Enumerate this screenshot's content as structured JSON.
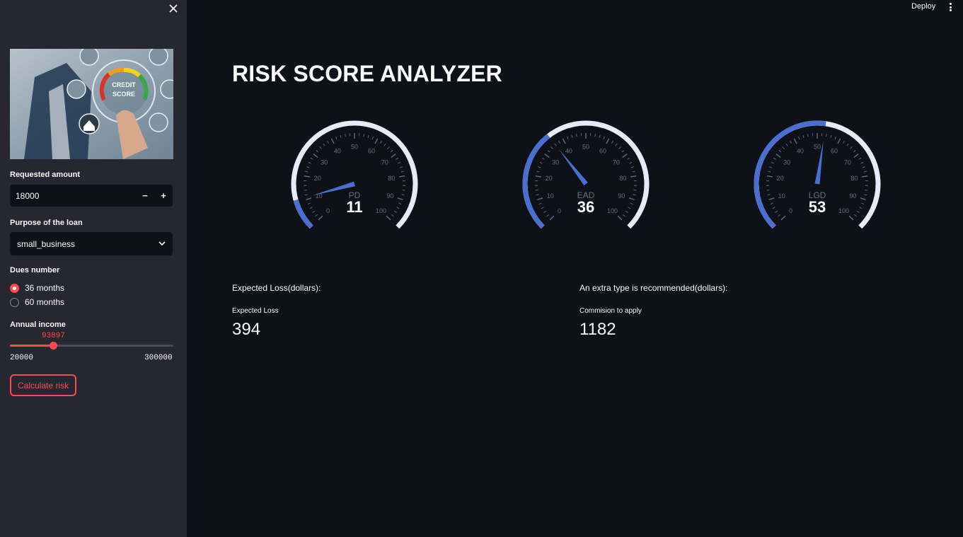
{
  "sidebar": {
    "image": {
      "title_line1": "CREDIT",
      "title_line2": "SCORE"
    },
    "requested_amount": {
      "label": "Requested amount",
      "value": "18000",
      "decrement": "−",
      "increment": "+"
    },
    "purpose": {
      "label": "Purpose of the loan",
      "value": "small_business"
    },
    "dues": {
      "label": "Dues number",
      "options": [
        "36 months",
        "60 months"
      ],
      "selected": 0
    },
    "income": {
      "label": "Annual income",
      "value": "93897",
      "min": "20000",
      "max": "300000",
      "value_num": 93897,
      "min_num": 20000,
      "max_num": 300000
    },
    "calculate_label": "Calculate risk"
  },
  "header": {
    "deploy_label": "Deploy"
  },
  "main": {
    "title": "RISK SCORE ANALYZER",
    "gauges": [
      {
        "name": "PD",
        "value": 11
      },
      {
        "name": "EAD",
        "value": 36
      },
      {
        "name": "LGD",
        "value": 53
      }
    ],
    "gauge_ticks": [
      "0",
      "10",
      "20",
      "30",
      "40",
      "50",
      "60",
      "70",
      "80",
      "90",
      "100"
    ],
    "expected_loss": {
      "heading": "Expected Loss(dollars):",
      "label": "Expected Loss",
      "value": "394"
    },
    "commission": {
      "heading": "An extra type is recommended(dollars):",
      "label": "Commision to apply",
      "value": "1182"
    }
  },
  "colors": {
    "accent": "#ff4b4b",
    "gauge_bar": "#4a6fd1",
    "gauge_bg": "#e6ebf7",
    "sidebar_bg": "#262730",
    "main_bg": "#0e1117"
  }
}
